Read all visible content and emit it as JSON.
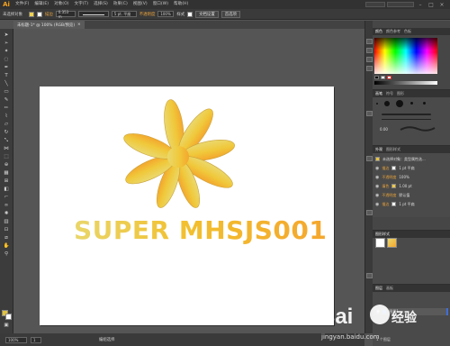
{
  "app": {
    "logo": "Ai"
  },
  "menubar": {
    "items": [
      "文件(F)",
      "编辑(E)",
      "对象(O)",
      "文字(T)",
      "选择(S)",
      "效果(C)",
      "视图(V)",
      "窗口(W)",
      "帮助(H)"
    ]
  },
  "controlbar": {
    "selection_label": "未选择对象",
    "stroke_label": "描边",
    "stroke_weight": "0.353 m",
    "points": "5 pt. 平扁",
    "opacity_label": "不透明度",
    "opacity_value": "100%",
    "style_label": "样式",
    "doc_settings_button": "文档设置",
    "preferences_button": "首选项"
  },
  "document": {
    "tab_title": "未标题-1* @ 100% (RGB/预览)",
    "close_glyph": "×"
  },
  "artwork": {
    "headline": "SUPER MHSJS001",
    "colors": [
      "#e9d66a",
      "#f2c02e",
      "#f4a72e"
    ]
  },
  "statusbar": {
    "zoom": "100%",
    "page": "1",
    "tool_label": "编组选择"
  },
  "panels": {
    "color_tabs": [
      "颜色",
      "颜色参考",
      "色板"
    ],
    "brush_tabs": [
      "画笔",
      "符号",
      "图形"
    ],
    "brush_value": "0.00",
    "appearance_tabs": [
      "外观",
      "图形样式"
    ],
    "appearance_title": "未选择对象：类型属性选...",
    "appearance_rows": [
      {
        "label": "描边",
        "value": "1 pt 平扁"
      },
      {
        "label": "不透明度",
        "value": "100%"
      },
      {
        "label": "填色",
        "value": "1.00 pt"
      },
      {
        "label": "不透明度",
        "value": "默认值"
      },
      {
        "label": "描边",
        "value": "1 pt 平扁"
      }
    ],
    "gradient_title": "图形样式",
    "layers_tabs": [
      "图层",
      "画板"
    ],
    "layer_name": "图层1",
    "layers_footer": "1 个图层"
  },
  "watermark": {
    "brand": "Bai",
    "brand_suffix": "经验",
    "url": "jingyan.baidu.com"
  }
}
